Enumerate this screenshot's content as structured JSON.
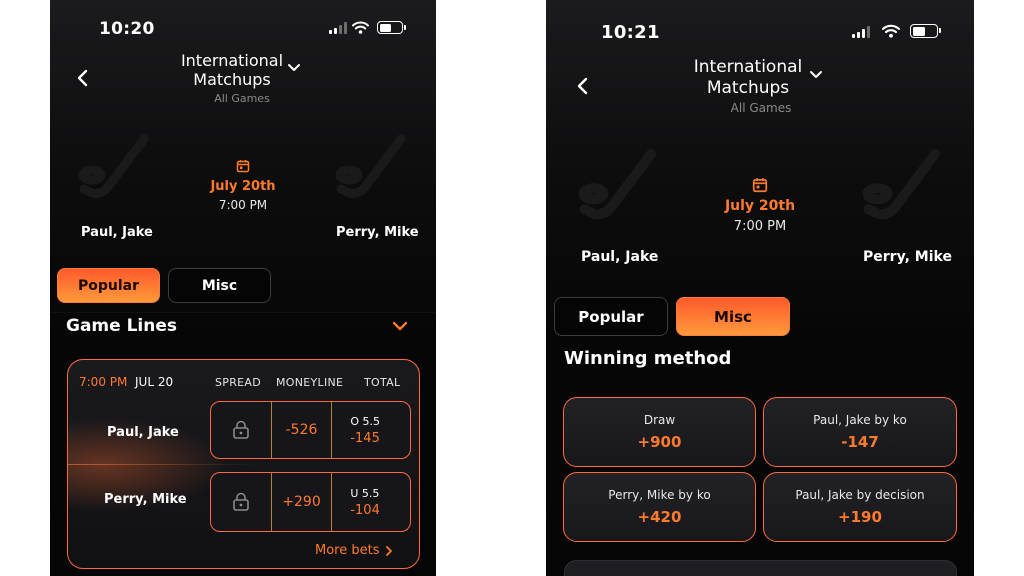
{
  "screens": [
    {
      "status_time": "10:20",
      "header": {
        "title_line1": "International",
        "title_line2": "Matchups",
        "subtitle": "All Games"
      },
      "event": {
        "date": "July 20th",
        "time": "7:00 PM",
        "fighter_left": "Paul, Jake",
        "fighter_right": "Perry, Mike"
      },
      "tabs": [
        {
          "label": "Popular",
          "active": true
        },
        {
          "label": "Misc",
          "active": false
        }
      ],
      "section_title": "Game Lines",
      "lines": {
        "time": "7:00 PM",
        "date": "JUL 20",
        "columns": [
          "SPREAD",
          "MONEYLINE",
          "TOTAL"
        ],
        "rows": [
          {
            "name": "Paul, Jake",
            "moneyline": "-526",
            "total_line": "O 5.5",
            "total_odds": "-145"
          },
          {
            "name": "Perry, Mike",
            "moneyline": "+290",
            "total_line": "U 5.5",
            "total_odds": "-104"
          }
        ],
        "more_bets": "More bets"
      }
    },
    {
      "status_time": "10:21",
      "header": {
        "title_line1": "International",
        "title_line2": "Matchups",
        "subtitle": "All Games"
      },
      "event": {
        "date": "July 20th",
        "time": "7:00 PM",
        "fighter_left": "Paul, Jake",
        "fighter_right": "Perry, Mike"
      },
      "tabs": [
        {
          "label": "Popular",
          "active": false
        },
        {
          "label": "Misc",
          "active": true
        }
      ],
      "section_title": "Winning method",
      "winning_methods": [
        {
          "label": "Draw",
          "odds": "+900"
        },
        {
          "label": "Paul, Jake by ko",
          "odds": "-147"
        },
        {
          "label": "Perry, Mike by ko",
          "odds": "+420"
        },
        {
          "label": "Paul, Jake by decision",
          "odds": "+190"
        }
      ]
    }
  ],
  "icons": {
    "back": "chevron-left-icon",
    "dropdown": "chevron-down-icon",
    "calendar": "calendar-icon",
    "team_logo": "hockey-stick-icon",
    "lock": "lock-icon",
    "more": "chevron-right-icon"
  },
  "colors": {
    "accent": "#ff7a2c",
    "accent_gradient_start": "#ff5a2c",
    "accent_gradient_end": "#ff9a3a",
    "background": "#050505"
  }
}
